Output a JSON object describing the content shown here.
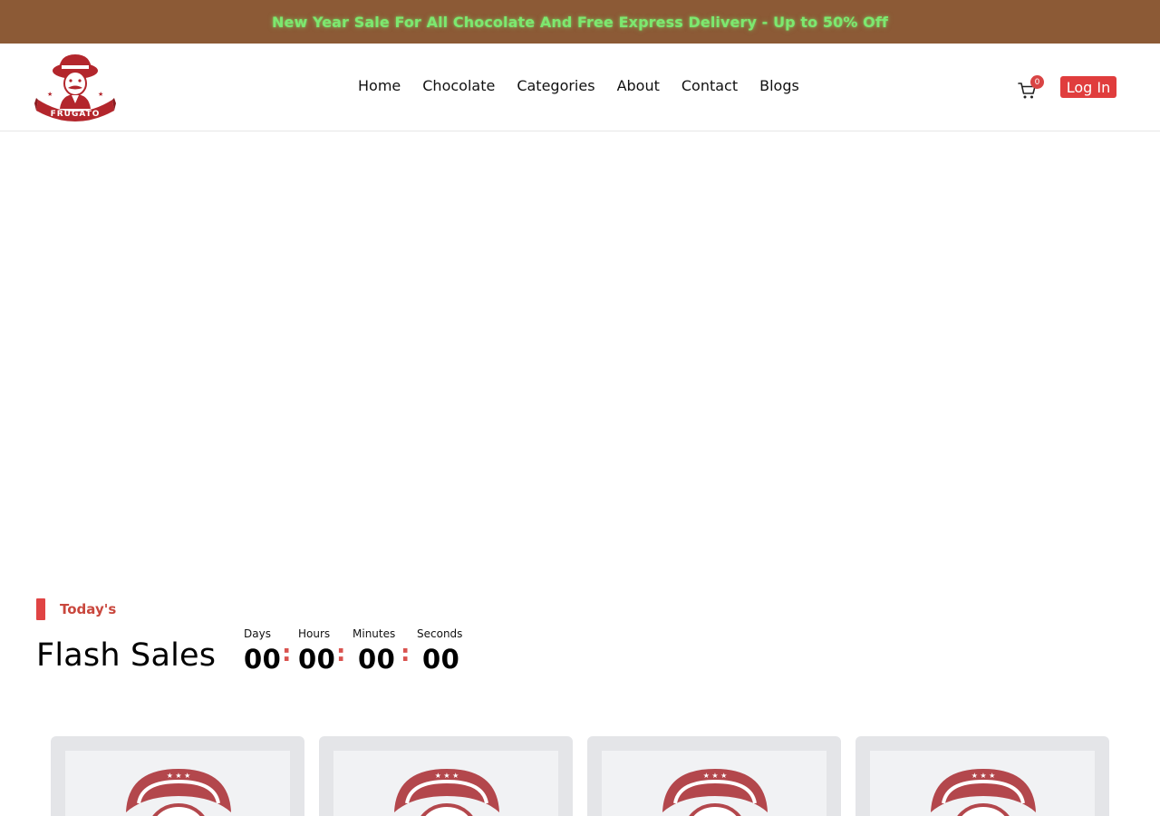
{
  "promo": {
    "text": "New Year Sale For All Chocolate And Free Express Delivery - Up to 50% Off"
  },
  "brand": {
    "logo_text": "FRUGATO",
    "logo_icon": "frugato-chef-logo"
  },
  "nav": {
    "items": [
      {
        "label": "Home"
      },
      {
        "label": "Chocolate"
      },
      {
        "label": "Categories"
      },
      {
        "label": "About"
      },
      {
        "label": "Contact"
      },
      {
        "label": "Blogs"
      }
    ]
  },
  "header": {
    "cart_icon": "cart-icon",
    "cart_count": "0",
    "login_label": "Log In"
  },
  "flash_sales": {
    "eyebrow": "Today's",
    "title": "Flash Sales",
    "countdown": [
      {
        "label": "Days",
        "value": "00"
      },
      {
        "label": "Hours",
        "value": "00"
      },
      {
        "label": "Minutes",
        "value": "00"
      },
      {
        "label": "Seconds",
        "value": "00"
      }
    ],
    "separator": ":"
  },
  "colors": {
    "promo_bg": "#8c5a36",
    "promo_text": "#7de86f",
    "accent_red": "#e03d3d",
    "card_bg": "#e4e5e8",
    "logo_red": "#b3262c"
  }
}
